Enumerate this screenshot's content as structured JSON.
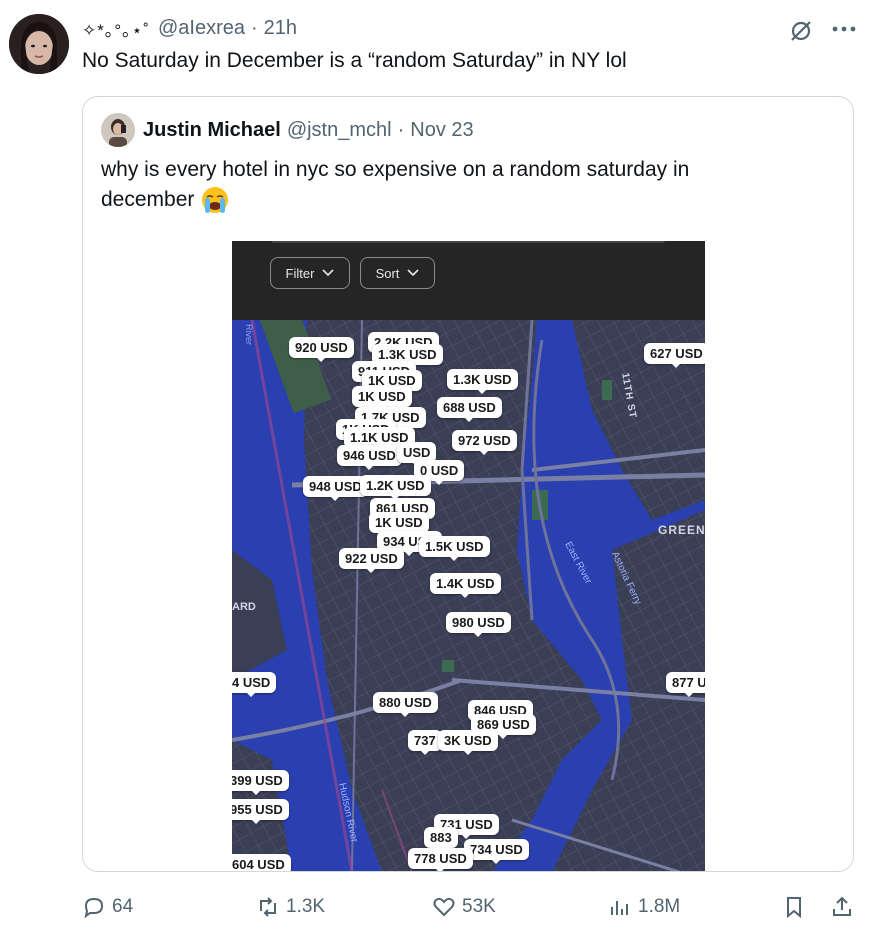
{
  "post": {
    "display_name": "✧*｡°｡⋆˚",
    "handle": "@aIexrea",
    "separator": "·",
    "time": "21h",
    "text": "No Saturday in December is a “random Saturday” in NY lol"
  },
  "quote": {
    "display_name": "Justin Michael",
    "handle": "@jstn_mchl",
    "separator": "·",
    "date": "Nov 23",
    "text_line1": "why is every hotel in nyc so expensive on a random saturday in",
    "text_line2": "december",
    "emoji_name": "loudly-crying-face",
    "media": {
      "filter_label": "Filter",
      "sort_label": "Sort",
      "map_labels": {
        "street": "11TH ST",
        "area": "GREENP",
        "river_east": "East River",
        "ferry": "Astoria Ferry",
        "river_hudson": "Hudson River",
        "left_edge": "ARD",
        "top_edge": "River"
      },
      "price_pins": [
        "920 USD",
        "2.2K USD",
        "1.3K USD",
        "911 USD",
        "1K USD",
        "1.3K USD",
        "1K USD",
        "688 USD",
        "1.7K USD",
        "1K USD",
        "1.1K USD",
        "972 USD",
        "946 USD",
        "USD",
        "0 USD",
        "948 USD",
        "1.2K USD",
        "861 USD",
        "1K USD",
        "934 USD",
        "1.5K USD",
        "922 USD",
        "1.4K USD",
        "980 USD",
        "627 USD",
        "4 USD",
        "877 U",
        "880 USD",
        "846 USD",
        "869 USD",
        "737",
        "3K USD",
        "399 USD",
        "955 USD",
        "604 USD",
        "731 USD",
        "883",
        "734 USD",
        "778 USD"
      ]
    }
  },
  "actions": {
    "replies": "64",
    "reposts": "1.3K",
    "likes": "53K",
    "views": "1.8M"
  },
  "colors": {
    "text_primary": "#0f1419",
    "text_secondary": "#536471",
    "border": "#cfd9de",
    "map_water": "#2a3fb0",
    "map_land": "#3a3f55"
  }
}
